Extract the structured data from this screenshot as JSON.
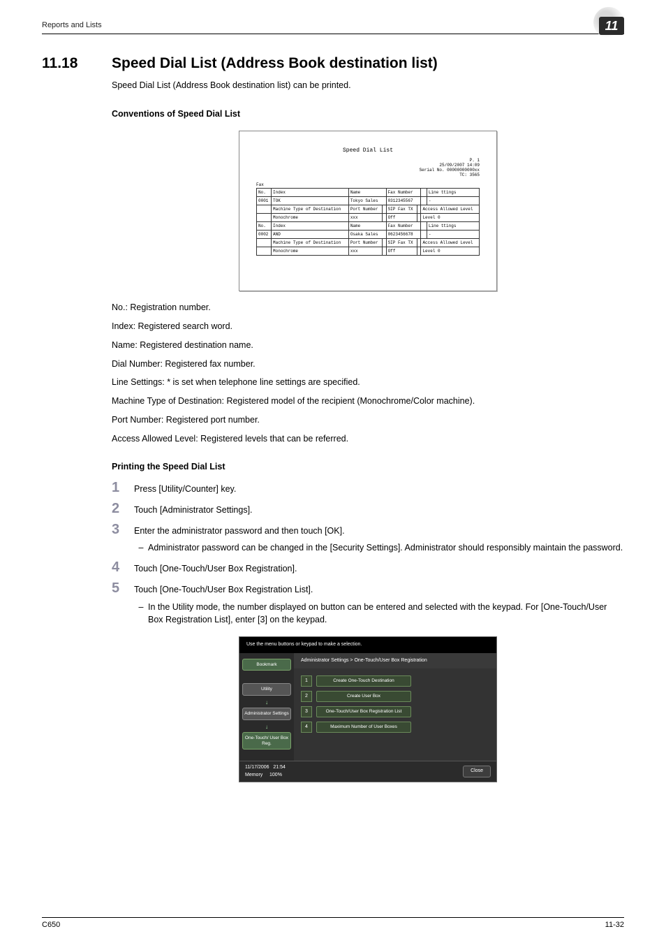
{
  "run_head": "Reports and Lists",
  "chapter_num": "11",
  "section_no": "11.18",
  "section_title": "Speed Dial List (Address Book destination list)",
  "intro": "Speed Dial List (Address Book destination list) can be printed.",
  "sub_conventions": "Conventions of Speed Dial List",
  "report": {
    "title": "Speed Dial List",
    "meta_line1": "P.  1",
    "meta_line2": "25/09/2007 14:09",
    "meta_line3": "Serial No.  00000000000xx",
    "meta_line4": "TC:   3565",
    "group": "Fax",
    "headers": {
      "no": "No.",
      "index": "Index",
      "name": "Name",
      "fax": "Fax Number",
      "line": "Line ttings"
    },
    "rows": [
      {
        "no": "0001",
        "index": "TOK",
        "name": "Tokyo Sales",
        "fax": "0312345567",
        "line": "-"
      },
      {
        "no": "0002",
        "index": "AND",
        "name": "Osaka Sales",
        "fax": "0623456678",
        "line": "-"
      }
    ],
    "sub_labels": {
      "mtype_l": "Machine Type of",
      "mtype_r": "Destination",
      "port": "Port Number",
      "sip": "SIP Fax TX",
      "access": "Access Allowed",
      "level": "Level"
    },
    "sub_rows": [
      {
        "mtype": "Monochrome",
        "port": "xxx",
        "sip": "Off",
        "access": "Level 0"
      },
      {
        "mtype": "Monochrome",
        "port": "xxx",
        "sip": "Off",
        "access": "Level 0"
      }
    ]
  },
  "defs": [
    "No.: Registration number.",
    "Index: Registered search word.",
    "Name: Registered destination name.",
    "Dial Number: Registered fax number.",
    "Line Settings: * is set when telephone line settings are specified.",
    "Machine Type of Destination: Registered model of the recipient (Monochrome/Color machine).",
    "Port Number: Registered port number.",
    "Access Allowed Level: Registered levels that can be referred."
  ],
  "sub_printing": "Printing the Speed Dial List",
  "steps": [
    {
      "n": "1",
      "text": "Press [Utility/Counter] key."
    },
    {
      "n": "2",
      "text": "Touch [Administrator Settings]."
    },
    {
      "n": "3",
      "text": "Enter the administrator password and then touch [OK].",
      "sub": "Administrator password can be changed in the [Security Settings]. Administrator should responsibly maintain the password."
    },
    {
      "n": "4",
      "text": "Touch [One-Touch/User Box Registration]."
    },
    {
      "n": "5",
      "text": "Touch [One-Touch/User Box Registration List].",
      "sub": "In the Utility mode, the number displayed on button can be entered and selected with the keypad. For [One-Touch/User Box Registration List], enter [3] on the keypad."
    }
  ],
  "shot": {
    "top": "Use the menu buttons or keypad to make a selection.",
    "crumb": "Administrator Settings > One-Touch/User Box Registration",
    "side": {
      "bookmark": "Bookmark",
      "utility": "Utility",
      "admin": "Administrator Settings",
      "onetouch": "One-Touch/ User Box Reg."
    },
    "menu": [
      {
        "n": "1",
        "label": "Create One-Touch Destination"
      },
      {
        "n": "2",
        "label": "Create User Box"
      },
      {
        "n": "3",
        "label": "One-Touch/User Box Registration List"
      },
      {
        "n": "4",
        "label": "Maximum Number of User Boxes"
      }
    ],
    "footer_date": "11/17/2006",
    "footer_time": "21:54",
    "footer_mem": "Memory",
    "footer_pct": "100%",
    "close": "Close"
  },
  "footer_left": "C650",
  "footer_right": "11-32"
}
